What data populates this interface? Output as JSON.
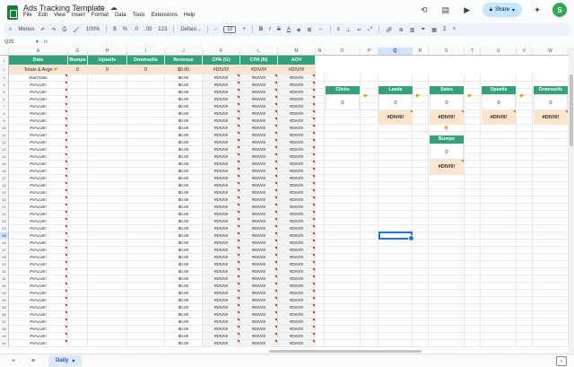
{
  "app": {
    "title": "Ads Tracking Template",
    "menus": [
      "File",
      "Edit",
      "View",
      "Insert",
      "Format",
      "Data",
      "Tools",
      "Extensions",
      "Help"
    ],
    "share_label": "Share",
    "avatar_letter": "S"
  },
  "toolbar": {
    "menus_label": "Menus",
    "zoom": "100%",
    "currency": "$",
    "percent": "%",
    "dec_decrease": ".0",
    "dec_increase": ".00",
    "number_format": "123",
    "font": "Defaul...",
    "font_size": "10",
    "bold": "B",
    "italic": "I",
    "text_color": "A"
  },
  "formula_bar": {
    "cell_ref": "Q25",
    "fx": "fx"
  },
  "columns": [
    "A",
    "G",
    "H",
    "I",
    "J",
    "K",
    "L",
    "M",
    "N",
    "O",
    "P",
    "Q",
    "R",
    "S",
    "T",
    "U",
    "V",
    "W"
  ],
  "headers": {
    "date": "Date",
    "bumps": "Bumps",
    "upsells": "Upsells",
    "downsells": "Downsells",
    "revenue": "Revenue",
    "cpa_g": "CPA (G)",
    "cpa_n": "CPA (N)",
    "aov": "AOV"
  },
  "totals": {
    "label": "Totals & Avgs",
    "bumps": "0",
    "upsells": "0",
    "downsells": "0",
    "revenue": "$0.00",
    "cpa_g": "#DIV/0!",
    "cpa_n": "#DIV/0!",
    "aov": "#DIV/0!"
  },
  "rows": {
    "first_date": "Start Date",
    "date_value": "#VALUE!",
    "revenue_value": "$0.00",
    "error_value": "#DIV/0!",
    "numbers": [
      "3",
      "4",
      "5",
      "6",
      "7",
      "8",
      "9",
      "10",
      "11",
      "12",
      "13",
      "14",
      "15",
      "16",
      "17",
      "18",
      "19",
      "20",
      "21",
      "22",
      "23",
      "24",
      "25",
      "26",
      "27",
      "28",
      "29",
      "30",
      "31",
      "32",
      "33",
      "34",
      "35",
      "36",
      "37",
      "38",
      "39",
      "40"
    ]
  },
  "flow": {
    "clicks": {
      "label": "Clicks",
      "value": "0"
    },
    "leads": {
      "label": "Leads",
      "value": "0",
      "rate": "#DIV/0!"
    },
    "sales": {
      "label": "Sales",
      "value": "0",
      "rate": "#DIV/0!"
    },
    "upsells": {
      "label": "Upsells",
      "value": "0",
      "rate": "#DIV/0!"
    },
    "downsells": {
      "label": "Downsells",
      "value": "0",
      "rate": "#DIV/0!"
    },
    "bumps": {
      "label": "Bumps",
      "value": "0",
      "rate": "#DIV/0!"
    }
  },
  "sheet": {
    "tab_name": "Daily"
  }
}
